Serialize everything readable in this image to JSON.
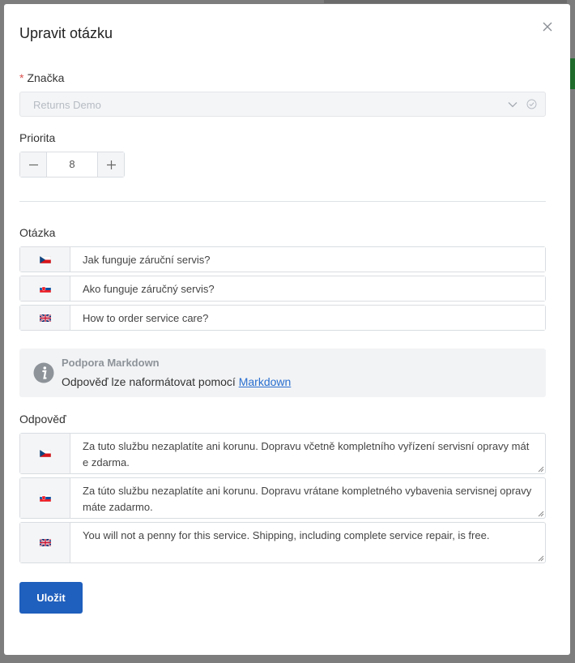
{
  "modal": {
    "title": "Upravit otázku",
    "close_icon": "close-icon"
  },
  "brand": {
    "required_mark": "*",
    "label": "Značka",
    "value": "Returns Demo",
    "chevron_icon": "chevron-down-icon",
    "check_icon": "check-circle-icon"
  },
  "priority": {
    "label": "Priorita",
    "value": "8",
    "minus_icon": "minus-icon",
    "plus_icon": "plus-icon"
  },
  "question": {
    "label": "Otázka",
    "rows": [
      {
        "flag": "cz-flag-icon",
        "value": "Jak funguje záruční servis?"
      },
      {
        "flag": "sk-flag-icon",
        "value": "Ako funguje záručný servis?"
      },
      {
        "flag": "gb-flag-icon",
        "value": "How to order service care?"
      }
    ]
  },
  "markdown_info": {
    "icon": "info-icon",
    "title": "Podpora Markdown",
    "text": "Odpověď lze naformátovat pomocí",
    "link": "Markdown"
  },
  "answer": {
    "label": "Odpověď",
    "rows": [
      {
        "flag": "cz-flag-icon",
        "value": "Za tuto službu nezaplatíte ani korunu. Dopravu včetně kompletního vyřízení servisní opravy máte zdarma."
      },
      {
        "flag": "sk-flag-icon",
        "value": "Za túto službu nezaplatíte ani korunu. Dopravu vrátane kompletného vybavenia servisnej opravy máte zadarmo."
      },
      {
        "flag": "gb-flag-icon",
        "value": "You will not a penny for this service. Shipping, including complete service repair, is free."
      }
    ]
  },
  "save_label": "Uložit",
  "colors": {
    "primary": "#1f5fbd",
    "required": "#d9534f",
    "link": "#2a6fcf"
  }
}
